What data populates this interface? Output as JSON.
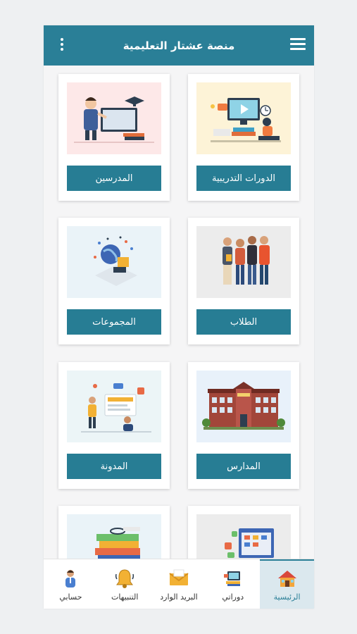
{
  "app": {
    "title": "منصة عشتار التعليمية",
    "theme_color": "#2a7f97",
    "menu_icon": "hamburger-menu-icon",
    "more_icon": "more-vertical-icon"
  },
  "cards": [
    {
      "label": "الدورات التدريبية",
      "icon": "training-courses-illustration"
    },
    {
      "label": "المدرسين",
      "icon": "teacher-illustration"
    },
    {
      "label": "الطلاب",
      "icon": "students-illustration"
    },
    {
      "label": "المجموعات",
      "icon": "groups-illustration"
    },
    {
      "label": "المدارس",
      "icon": "school-building-illustration"
    },
    {
      "label": "المدونة",
      "icon": "blog-illustration"
    },
    {
      "label": "",
      "icon": "schedule-illustration"
    },
    {
      "label": "",
      "icon": "books-illustration"
    }
  ],
  "bottom_nav": [
    {
      "label": "الرئيسية",
      "icon": "home-icon",
      "active": true
    },
    {
      "label": "دوراتي",
      "icon": "my-courses-icon",
      "active": false
    },
    {
      "label": "البريد الوارد",
      "icon": "inbox-mail-icon",
      "active": false
    },
    {
      "label": "التنبيهات",
      "icon": "bell-icon",
      "active": false
    },
    {
      "label": "حسابي",
      "icon": "account-icon",
      "active": false
    }
  ]
}
